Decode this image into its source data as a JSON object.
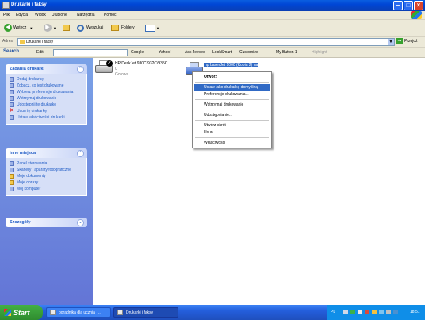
{
  "window": {
    "title": "Drukarki i faksy"
  },
  "menu": [
    "Plik",
    "Edycja",
    "Widok",
    "Ulubione",
    "Narzędzia",
    "Pomoc"
  ],
  "toolbar": {
    "back": "Wstecz",
    "search": "Wyszukaj",
    "folders": "Foldery"
  },
  "address": {
    "label": "Adres",
    "value": "Drukarki i faksy",
    "go": "Przejdź"
  },
  "googlebar": {
    "search": "Search",
    "edit": "Edit",
    "items": [
      "Google",
      "Yahoo!",
      "Ask Jeeves",
      "LookSmart",
      "Customize",
      "My Button 1",
      "Highlight"
    ]
  },
  "tasks_panel": {
    "title": "Zadania drukarki",
    "items": [
      "Dodaj drukarkę",
      "Zobacz, co jest drukowane",
      "Wybierz preferencje drukowania",
      "Wstrzymaj drukowanie",
      "Udostępnij tę drukarkę",
      "Usuń tę drukarkę",
      "Ustaw właściwości drukarki"
    ]
  },
  "other_panel": {
    "title": "Inne miejsca",
    "items": [
      "Panel sterowania",
      "Skanery i aparaty fotograficzne",
      "Moje dokumenty",
      "Moje obrazy",
      "Mój komputer"
    ]
  },
  "details_panel": {
    "title": "Szczegóły"
  },
  "printers": [
    {
      "name": "HP DeskJet 930C/932C/935C",
      "count": "0",
      "status": "Gotowa"
    },
    {
      "name": "hp LaserJet 1000 (Kopia 2) na"
    }
  ],
  "context_menu": {
    "items": [
      "Otwórz",
      "Ustaw jako drukarkę domyślną",
      "Preferencje drukowania...",
      "Wstrzymaj drukowanie",
      "Udostępnianie...",
      "Utwórz skrót",
      "Usuń",
      "Właściwości"
    ]
  },
  "taskbar": {
    "start": "Start",
    "tasks": [
      "poradnika dla ucznia_...",
      "Drukarki i faksy"
    ],
    "lang": "PL",
    "clock": "18:51"
  },
  "colors": {
    "titlebar": "#0a5ee0",
    "taskpane": "#6f8de0",
    "highlight": "#316ac5",
    "start": "#3c9c3c"
  }
}
